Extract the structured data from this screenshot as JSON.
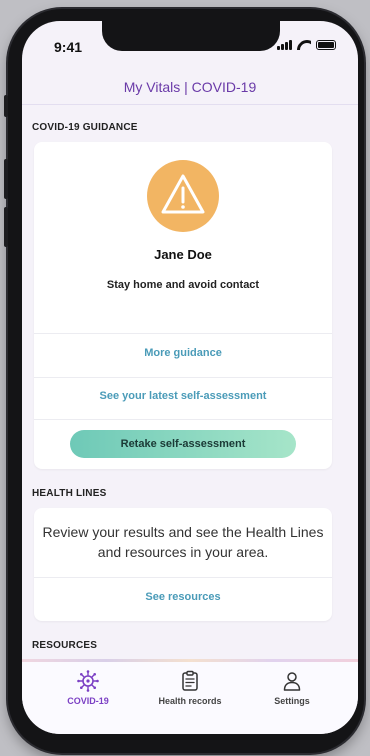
{
  "status_bar": {
    "time": "9:41"
  },
  "header": {
    "title": "My Vitals | COVID-19"
  },
  "guidance": {
    "heading": "COVID-19 GUIDANCE",
    "name": "Jane Doe",
    "instruction": "Stay home and avoid contact",
    "more_guidance": "More guidance",
    "latest_assessment": "See your latest self-assessment",
    "retake": "Retake self-assessment",
    "warning_color": "#f2b563"
  },
  "health_lines": {
    "heading": "HEALTH LINES",
    "description": "Review your results and see the Health Lines and resources in your area.",
    "link": "See resources"
  },
  "resources": {
    "heading": "RESOURCES"
  },
  "tabbar": {
    "tabs": [
      {
        "label": "COVID-19",
        "icon": "virus-icon",
        "active": true
      },
      {
        "label": "Health records",
        "icon": "clipboard-icon",
        "active": false
      },
      {
        "label": "Settings",
        "icon": "person-icon",
        "active": false
      }
    ],
    "accent": "#7b3fc4"
  }
}
